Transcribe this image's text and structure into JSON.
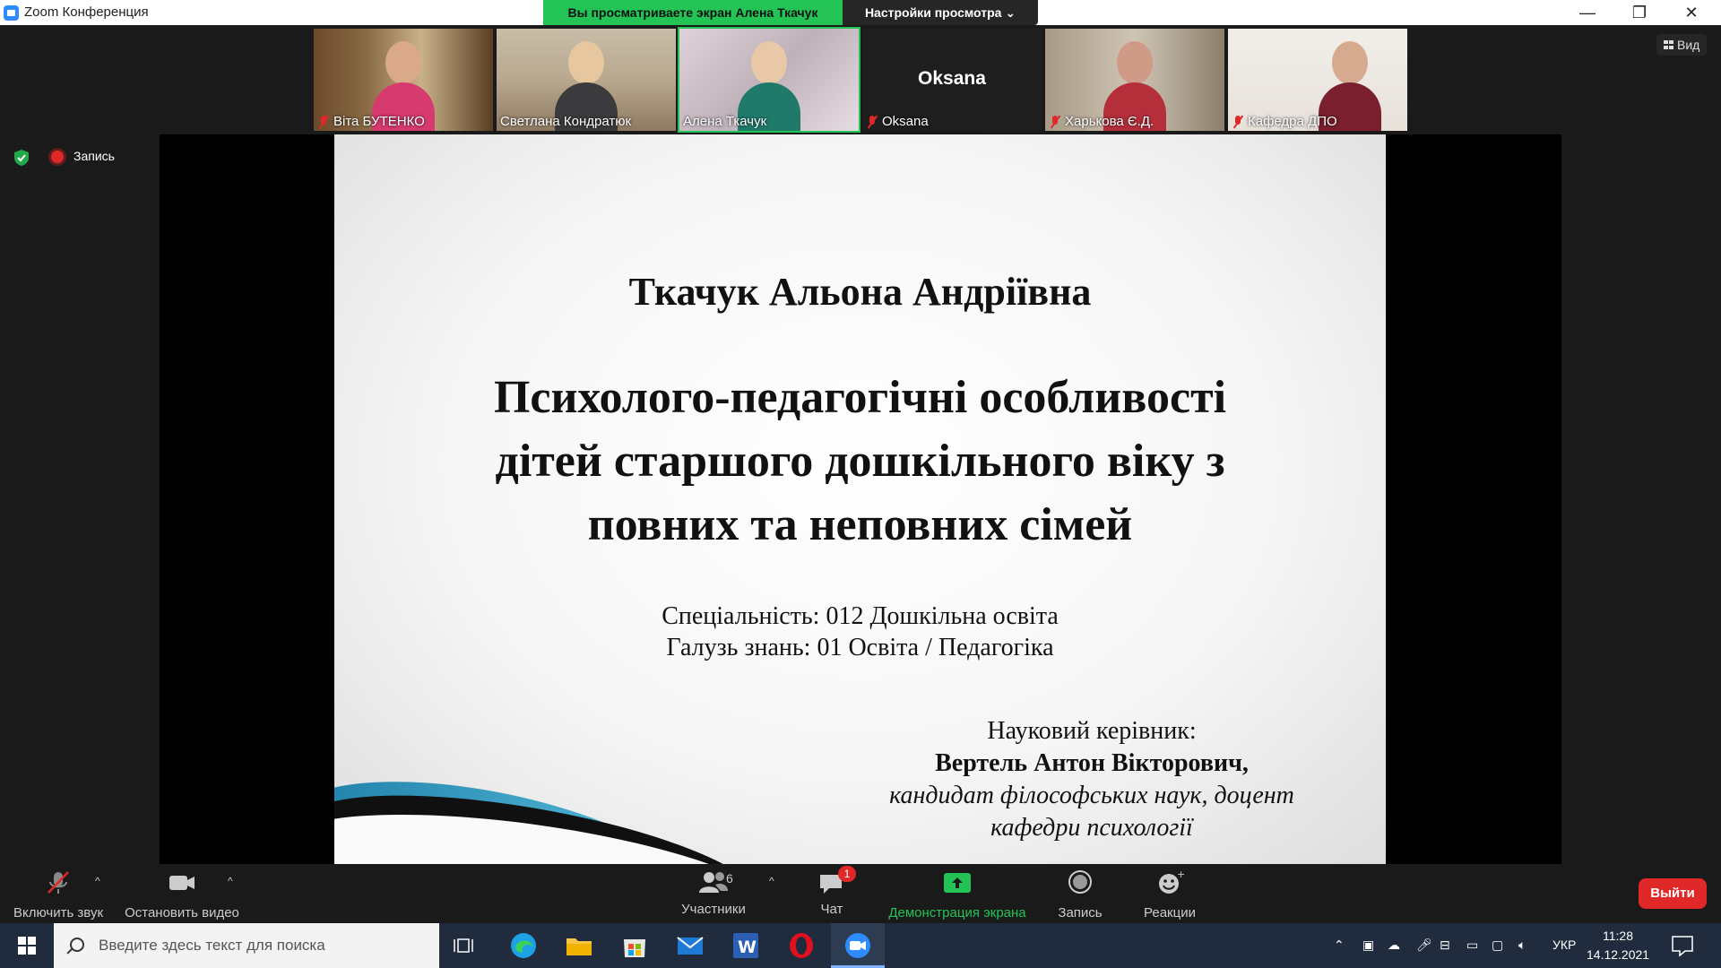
{
  "window": {
    "title": "Zoom Конференция",
    "share_banner": "Вы просматриваете экран Алена Ткачук",
    "view_settings": "Настройки просмотра"
  },
  "participants": [
    {
      "name": "Віта БУТЕНКО",
      "muted": true
    },
    {
      "name": "Светлана Кондратюк",
      "muted": false
    },
    {
      "name": "Алена Ткачук",
      "muted": false
    },
    {
      "name": "Oksana",
      "muted": true,
      "label": "Oksana"
    },
    {
      "name": "Харькова Є.Д.",
      "muted": true
    },
    {
      "name": "Кафедра ДПО",
      "muted": true
    }
  ],
  "view_button": "Вид",
  "recording": {
    "label": "Запись"
  },
  "slide": {
    "author": "Ткачук Альона Андріївна",
    "thesis_lines": [
      "Психолого-педагогічні особливості",
      "дітей старшого дошкільного віку з",
      "повних та неповних сімей"
    ],
    "specialty": "Спеціальність: 012 Дошкільна освіта",
    "field": "Галузь знань: 01 Освіта / Педагогіка",
    "supervisor_label": "Науковий керівник:",
    "supervisor_name": "Вертель Антон Вікторович,",
    "supervisor_title_1": "кандидат філософських наук, доцент",
    "supervisor_title_2": "кафедри психології"
  },
  "toolbar": {
    "unmute": "Включить звук",
    "stop_video": "Остановить видео",
    "participants": "Участники",
    "participants_count": "6",
    "chat": "Чат",
    "chat_badge": "1",
    "share_screen": "Демонстрация экрана",
    "record": "Запись",
    "reactions": "Реакции",
    "leave": "Выйти"
  },
  "taskbar": {
    "search_placeholder": "Введите здесь текст для поиска",
    "language": "УКР",
    "time": "11:28",
    "date": "14.12.2021"
  },
  "colors": {
    "accent_green": "#23c455",
    "leave_red": "#e02828",
    "zoom_blue": "#2d8cff"
  }
}
